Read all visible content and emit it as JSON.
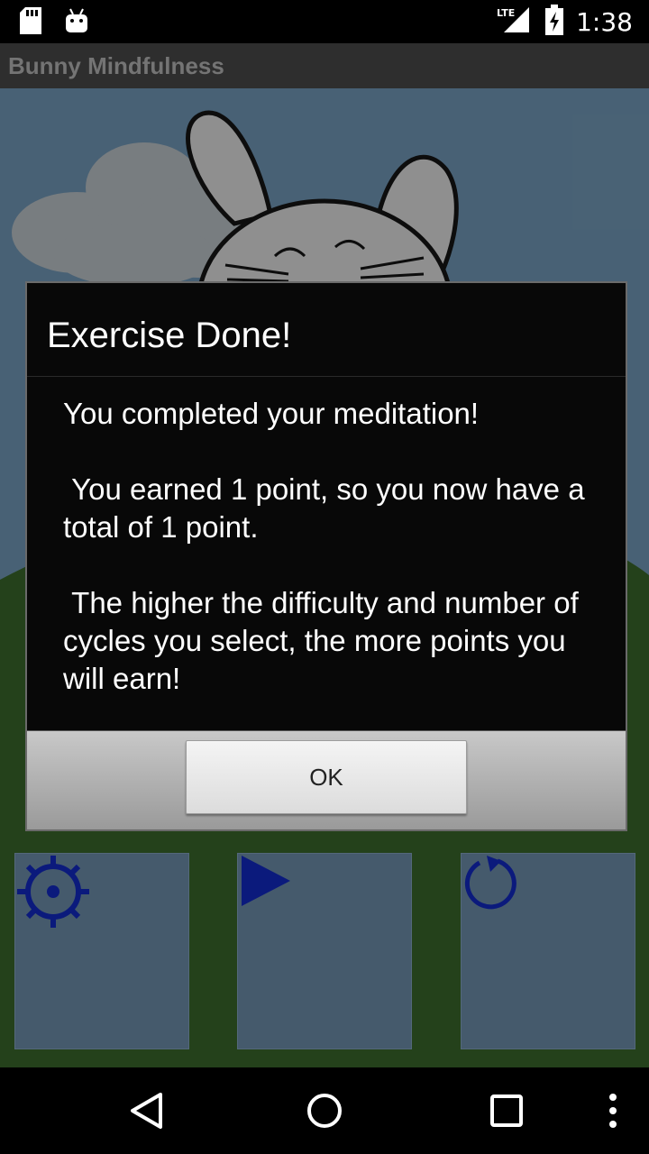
{
  "status_bar": {
    "time": "1:38",
    "network": "LTE",
    "icons": [
      "sd-card-icon",
      "android-debug-icon",
      "lte-signal-icon",
      "battery-charging-icon"
    ]
  },
  "app": {
    "title": "Bunny Mindfulness"
  },
  "dialog": {
    "title": "Exercise Done!",
    "paragraphs": [
      "You completed your meditation!",
      " You earned 1 point, so you now have a total of 1 point.",
      " The higher the difficulty and number of cycles you select, the more points you will earn!"
    ],
    "ok_label": "OK"
  },
  "controls": {
    "icons": [
      "settings-gear-icon",
      "play-icon",
      "restart-icon"
    ]
  },
  "nav_bar": {
    "icons": [
      "back-icon",
      "home-icon",
      "recents-icon",
      "overflow-menu-icon"
    ]
  },
  "colors": {
    "sky": "#5d7d96",
    "grass": "#2f5423",
    "control_icon": "#0b1a7c",
    "dialog_bg": "#080808"
  }
}
